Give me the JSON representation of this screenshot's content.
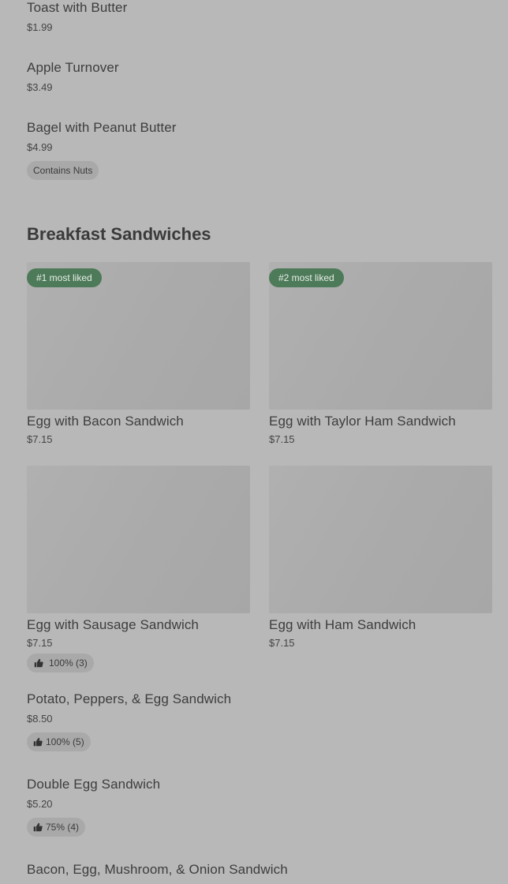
{
  "list_items_top": [
    {
      "name": "Toast with Butter",
      "price": "$1.99"
    },
    {
      "name": "Apple Turnover",
      "price": "$3.49"
    },
    {
      "name": "Bagel with Peanut Butter",
      "price": "$4.99",
      "tag": "Contains Nuts"
    }
  ],
  "section": {
    "title": "Breakfast Sandwiches"
  },
  "cards": [
    {
      "rank": "#1 most liked",
      "name": "Egg with Bacon Sandwich",
      "price": "$7.15"
    },
    {
      "rank": "#2 most liked",
      "name": "Egg with Taylor Ham Sandwich",
      "price": "$7.15"
    },
    {
      "name": "Egg with Sausage Sandwich",
      "price": "$7.15",
      "rating": "100% (3)"
    },
    {
      "name": "Egg with Ham Sandwich",
      "price": "$7.15"
    }
  ],
  "list_items_bottom": [
    {
      "name": "Potato, Peppers, & Egg Sandwich",
      "price": "$8.50",
      "rating": "100% (5)"
    },
    {
      "name": "Double Egg Sandwich",
      "price": "$5.20",
      "rating": "75% (4)"
    },
    {
      "name": "Bacon, Egg, Mushroom, & Onion Sandwich"
    }
  ],
  "colors": {
    "background": "#b8b8b8",
    "rank_badge": "#4d7a58",
    "pill": "#a9a9a9"
  },
  "icons": {
    "rating": "thumbs-up-icon"
  }
}
